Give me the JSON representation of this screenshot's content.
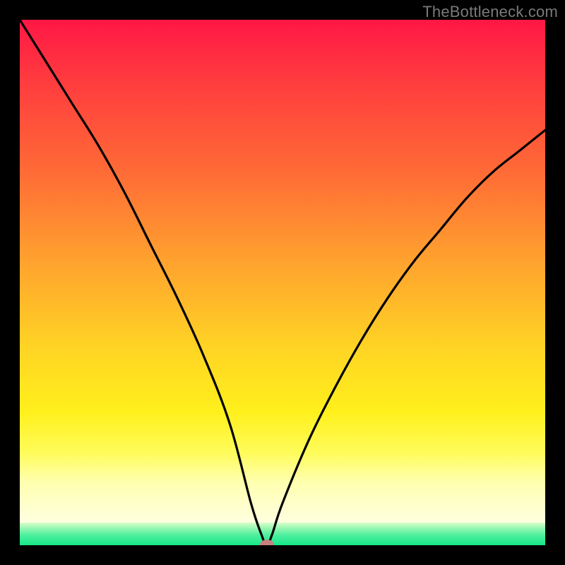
{
  "watermark": "TheBottleneck.com",
  "chart_data": {
    "type": "line",
    "title": "",
    "xlabel": "",
    "ylabel": "",
    "xlim": [
      0,
      100
    ],
    "ylim": [
      0,
      100
    ],
    "grid": false,
    "legend": false,
    "series": [
      {
        "name": "bottleneck-curve",
        "x": [
          0,
          5,
          10,
          15,
          20,
          25,
          30,
          35,
          40,
          44,
          46,
          47,
          48,
          50,
          55,
          60,
          65,
          70,
          75,
          80,
          85,
          90,
          95,
          100
        ],
        "y": [
          100,
          92,
          84,
          76,
          67,
          57,
          47,
          36,
          23,
          8,
          2,
          0,
          2,
          8,
          20,
          30,
          39,
          47,
          54,
          60,
          66,
          71,
          75,
          79
        ]
      }
    ],
    "marker": {
      "x": 47,
      "y": 0
    },
    "background_gradient": {
      "stops": [
        {
          "pos": 0.0,
          "color": "#ff1745"
        },
        {
          "pos": 0.12,
          "color": "#ff3b3f"
        },
        {
          "pos": 0.3,
          "color": "#ff6a36"
        },
        {
          "pos": 0.48,
          "color": "#ffa22e"
        },
        {
          "pos": 0.65,
          "color": "#ffd324"
        },
        {
          "pos": 0.78,
          "color": "#fff01c"
        },
        {
          "pos": 0.86,
          "color": "#fffc5a"
        },
        {
          "pos": 0.92,
          "color": "#ffffb0"
        },
        {
          "pos": 0.96,
          "color": "#ffffe0"
        },
        {
          "pos": 0.965,
          "color": "#d8ffc8"
        },
        {
          "pos": 0.975,
          "color": "#96f7b2"
        },
        {
          "pos": 0.99,
          "color": "#4def9e"
        },
        {
          "pos": 1.0,
          "color": "#17e889"
        }
      ]
    }
  }
}
